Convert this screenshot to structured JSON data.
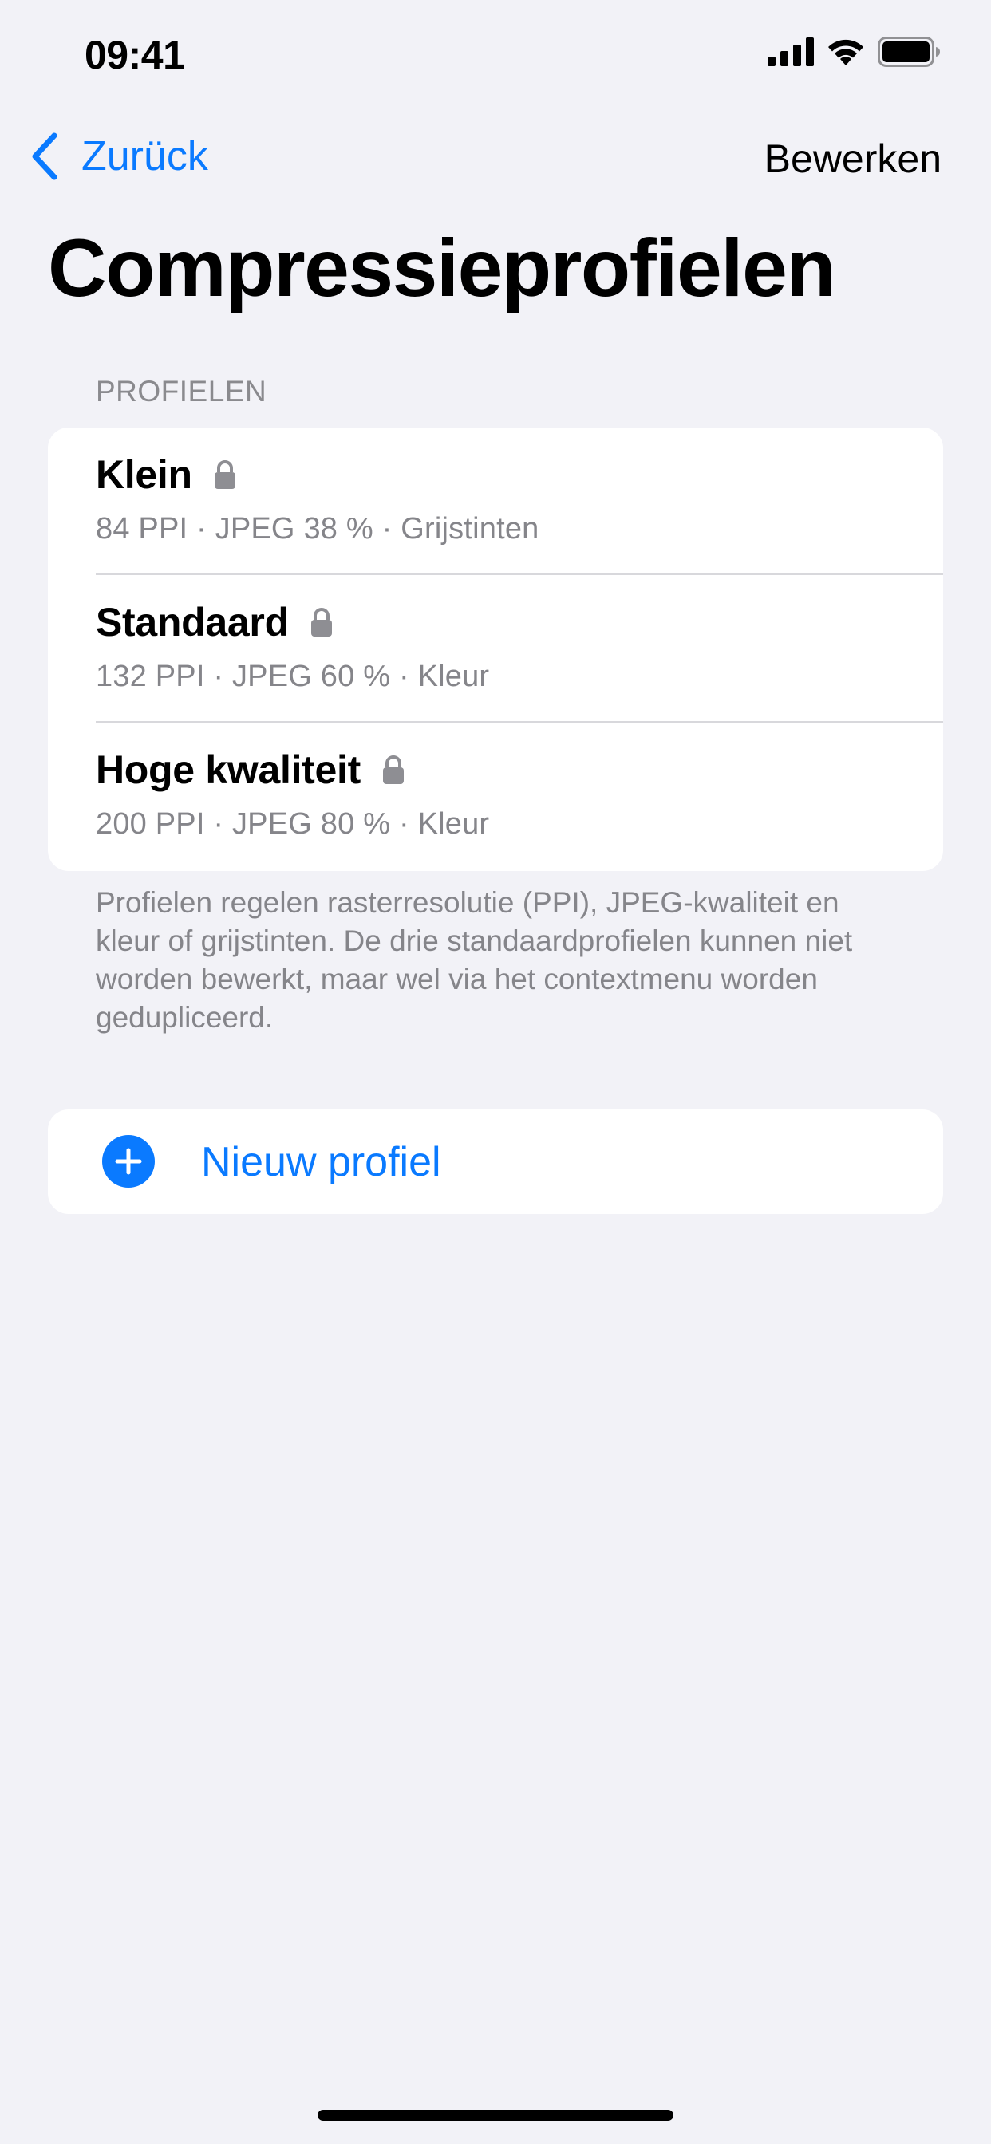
{
  "status_bar": {
    "time": "09:41"
  },
  "nav": {
    "back_label": "Zurück",
    "edit_label": "Bewerken"
  },
  "title": "Compressieprofielen",
  "section_header": "PROFIELEN",
  "profiles": [
    {
      "name": "Klein",
      "detail": "84 PPI · JPEG 38 % · Grijstinten",
      "locked": true
    },
    {
      "name": "Standaard",
      "detail": "132 PPI · JPEG 60 % · Kleur",
      "locked": true
    },
    {
      "name": "Hoge kwaliteit",
      "detail": "200 PPI · JPEG 80 % · Kleur",
      "locked": true
    }
  ],
  "footer_note": "Profielen regelen rasterresolutie (PPI), JPEG-kwaliteit en kleur of grijstinten. De drie standaardprofielen kunnen niet worden bewerkt, maar wel via het contextmenu worden gedupliceerd.",
  "new_profile_label": "Nieuw profiel",
  "colors": {
    "accent": "#0A7AFF",
    "background": "#F2F2F7",
    "secondary_text": "#85858A",
    "lock": "#8E8E93"
  },
  "icons": {
    "back": "chevron-left-icon",
    "lock": "lock-icon",
    "add": "plus-circle-icon",
    "signal": "cellular-signal-icon",
    "wifi": "wifi-icon",
    "battery": "battery-icon"
  }
}
